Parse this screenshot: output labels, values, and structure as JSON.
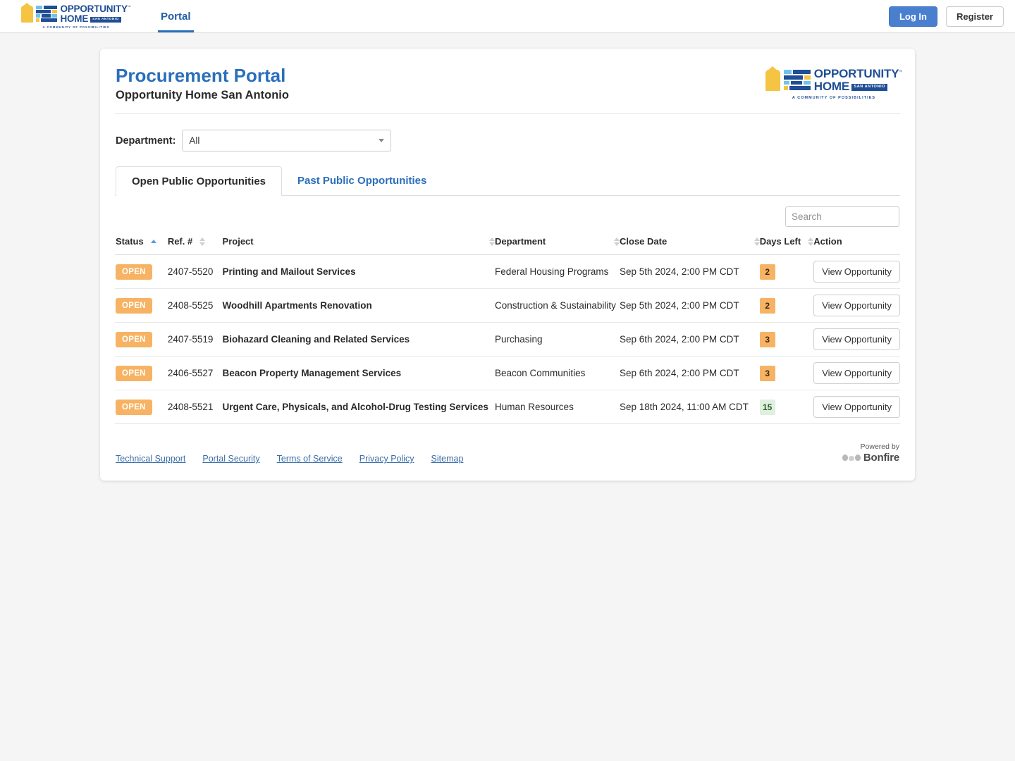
{
  "topnav": {
    "logo": {
      "word1": "OPPORTUNITY",
      "word2": "HOME",
      "badge": "SAN ANTONIO",
      "tagline": "A COMMUNITY OF POSSIBILITIES",
      "trademark": "™"
    },
    "tab_label": "Portal",
    "login_label": "Log In",
    "register_label": "Register"
  },
  "card": {
    "title": "Procurement Portal",
    "subtitle": "Opportunity Home San Antonio",
    "logo": {
      "word1": "OPPORTUNITY",
      "word2": "HOME",
      "badge": "SAN ANTONIO",
      "tagline": "A COMMUNITY OF POSSIBILITIES",
      "trademark": "™"
    }
  },
  "filter": {
    "label": "Department:",
    "selected": "All",
    "options": [
      "All"
    ]
  },
  "tabs": [
    {
      "label": "Open Public Opportunities",
      "active": true
    },
    {
      "label": "Past Public Opportunities",
      "active": false
    }
  ],
  "search": {
    "placeholder": "Search",
    "value": ""
  },
  "table": {
    "columns": [
      {
        "label": "Status",
        "sort": "asc"
      },
      {
        "label": "Ref. #",
        "sort": "none"
      },
      {
        "label": "Project",
        "sort": "none"
      },
      {
        "label": "Department",
        "sort": "none"
      },
      {
        "label": "Close Date",
        "sort": "none"
      },
      {
        "label": "Days Left",
        "sort": "none"
      },
      {
        "label": "Action",
        "sort": null
      }
    ],
    "action_label": "View Opportunity",
    "rows": [
      {
        "status": "OPEN",
        "ref": "2407-5520",
        "project": "Printing and Mailout Services",
        "department": "Federal Housing Programs",
        "close_date": "Sep 5th 2024, 2:00 PM CDT",
        "days_left": "2",
        "days_level": "warn"
      },
      {
        "status": "OPEN",
        "ref": "2408-5525",
        "project": "Woodhill Apartments Renovation",
        "department": "Construction & Sustainability",
        "close_date": "Sep 5th 2024, 2:00 PM CDT",
        "days_left": "2",
        "days_level": "warn"
      },
      {
        "status": "OPEN",
        "ref": "2407-5519",
        "project": "Biohazard Cleaning and Related Services",
        "department": "Purchasing",
        "close_date": "Sep 6th 2024, 2:00 PM CDT",
        "days_left": "3",
        "days_level": "warn"
      },
      {
        "status": "OPEN",
        "ref": "2406-5527",
        "project": "Beacon Property Management Services",
        "department": "Beacon Communities",
        "close_date": "Sep 6th 2024, 2:00 PM CDT",
        "days_left": "3",
        "days_level": "warn"
      },
      {
        "status": "OPEN",
        "ref": "2408-5521",
        "project": "Urgent Care, Physicals, and Alcohol-Drug Testing Services",
        "department": "Human Resources",
        "close_date": "Sep 18th 2024, 11:00 AM CDT",
        "days_left": "15",
        "days_level": "ok"
      }
    ]
  },
  "footer": {
    "links": [
      {
        "label": "Technical Support"
      },
      {
        "label": "Portal Security"
      },
      {
        "label": "Terms of Service"
      },
      {
        "label": "Privacy Policy"
      },
      {
        "label": "Sitemap"
      }
    ],
    "powered_by": "Powered by",
    "vendor": "Bonfire"
  },
  "colors": {
    "accent_blue": "#2a6fbb",
    "logo_blue": "#1f4e95",
    "logo_gold": "#f5c443",
    "badge_orange": "#f7b363",
    "badge_green_bg": "#dff0dd",
    "badge_green_text": "#2f5c2f",
    "page_bg": "#f5f5f5"
  }
}
